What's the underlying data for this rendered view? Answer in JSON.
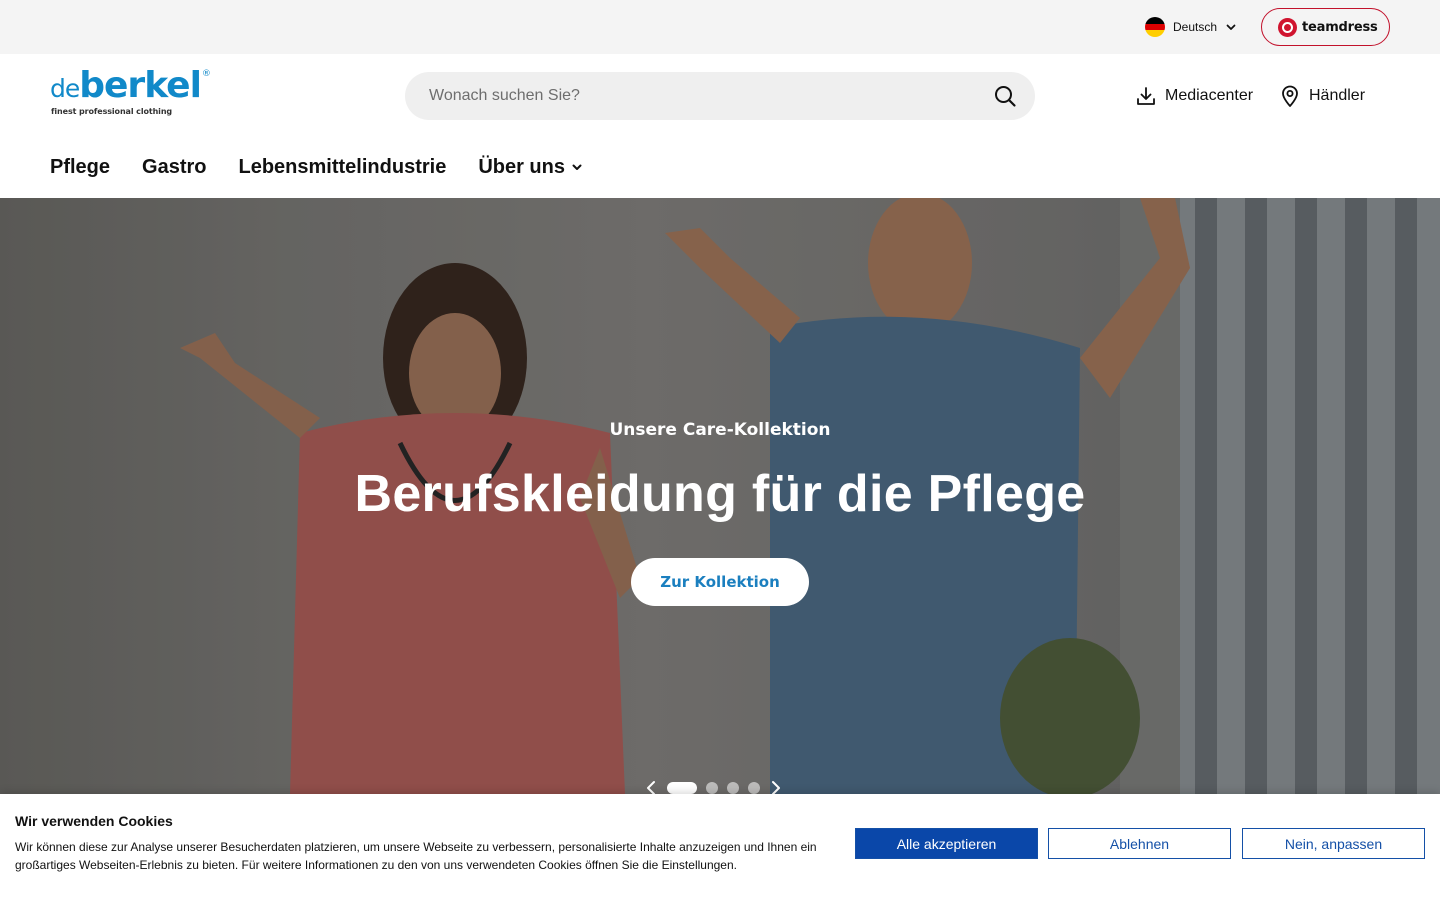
{
  "topbar": {
    "language": "Deutsch",
    "flag_colors": [
      "#000000",
      "#dd0000",
      "#ffce00"
    ],
    "teamdress_label": "teamdress",
    "teamdress_color": "#c2112b"
  },
  "header": {
    "logo": {
      "prefix": "de",
      "name": "berkel",
      "registered": "®",
      "tagline": "finest professional clothing",
      "color": "#1189c9"
    },
    "search": {
      "placeholder": "Wonach suchen Sie?",
      "value": ""
    },
    "mediacenter_label": "Mediacenter",
    "dealer_label": "Händler"
  },
  "nav": {
    "items": [
      {
        "label": "Pflege"
      },
      {
        "label": "Gastro"
      },
      {
        "label": "Lebensmittelindustrie"
      },
      {
        "label": "Über uns",
        "has_dropdown": true
      }
    ]
  },
  "hero": {
    "subtitle": "Unsere Care-Kollektion",
    "title": "Berufskleidung für die Pflege",
    "cta_label": "Zur Kollektion",
    "cta_color": "#1b7fbf",
    "slides_total": 4,
    "active_slide": 1
  },
  "cookie": {
    "title": "Wir verwenden Cookies",
    "text": "Wir können diese zur Analyse unserer Besucherdaten platzieren, um unsere Webseite zu verbessern, personalisierte Inhalte anzuzeigen und Ihnen ein großartiges Webseiten-Erlebnis zu bieten. Für weitere Informationen zu den von uns verwendeten Cookies öffnen Sie die Einstellungen.",
    "accept_label": "Alle akzeptieren",
    "reject_label": "Ablehnen",
    "customize_label": "Nein, anpassen",
    "accent_color": "#0a47a9"
  }
}
